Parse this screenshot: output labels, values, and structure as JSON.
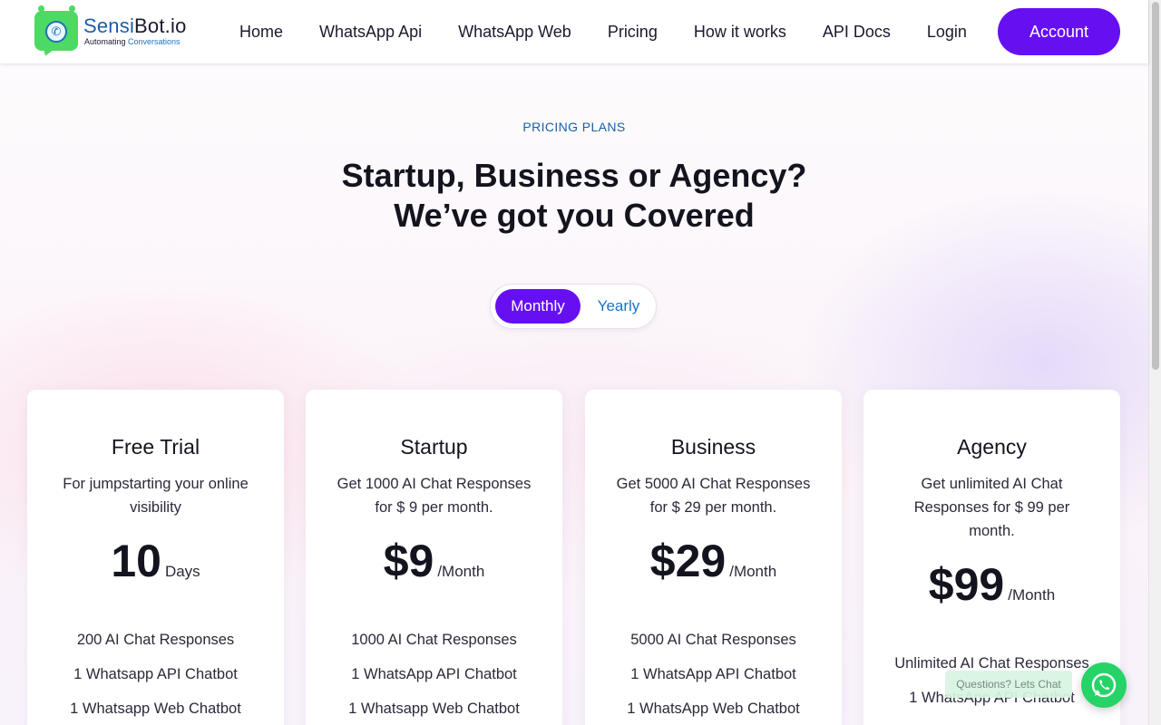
{
  "header": {
    "logo": {
      "name_a": "Sensi",
      "name_b": "Bot.io",
      "tagline_a": "Automating ",
      "tagline_b": "Conversations"
    },
    "nav": [
      "Home",
      "WhatsApp Api",
      "WhatsApp Web",
      "Pricing",
      "How it works",
      "API Docs",
      "Login"
    ],
    "account_label": "Account"
  },
  "hero": {
    "eyebrow": "PRICING PLANS",
    "headline_line1": "Startup, Business or Agency?",
    "headline_line2": "We’ve got you Covered"
  },
  "billing_toggle": {
    "monthly": "Monthly",
    "yearly": "Yearly",
    "selected": "Monthly"
  },
  "plans": [
    {
      "title": "Free Trial",
      "description": "For jumpstarting your online visibility",
      "price": "10",
      "unit": "Days",
      "features": [
        "200 AI Chat Responses",
        "1 Whatsapp API Chatbot",
        "1 Whatsapp Web Chatbot"
      ]
    },
    {
      "title": "Startup",
      "description": "Get 1000 AI Chat Responses for $ 9 per month.",
      "price": "$9",
      "unit": "/Month",
      "features": [
        "1000 AI Chat Responses",
        "1 WhatsApp API Chatbot",
        "1 Whatsapp Web Chatbot"
      ]
    },
    {
      "title": "Business",
      "description": "Get 5000 AI Chat Responses for $ 29 per month.",
      "price": "$29",
      "unit": "/Month",
      "features": [
        "5000 AI Chat Responses",
        "1 WhatsApp API Chatbot",
        "1 WhatsApp Web Chatbot"
      ]
    },
    {
      "title": "Agency",
      "description": "Get unlimited AI Chat Responses for $ 99 per month.",
      "price": "$99",
      "unit": "/Month",
      "features": [
        "Unlimited AI Chat Responses",
        "1 WhatsApp API Chatbot"
      ]
    }
  ],
  "chat_widget": {
    "prompt": "Questions? Lets Chat",
    "icon": "whatsapp-icon"
  },
  "colors": {
    "accent": "#6610f2",
    "link_blue": "#1a5fa8",
    "whatsapp_green": "#25d366"
  }
}
